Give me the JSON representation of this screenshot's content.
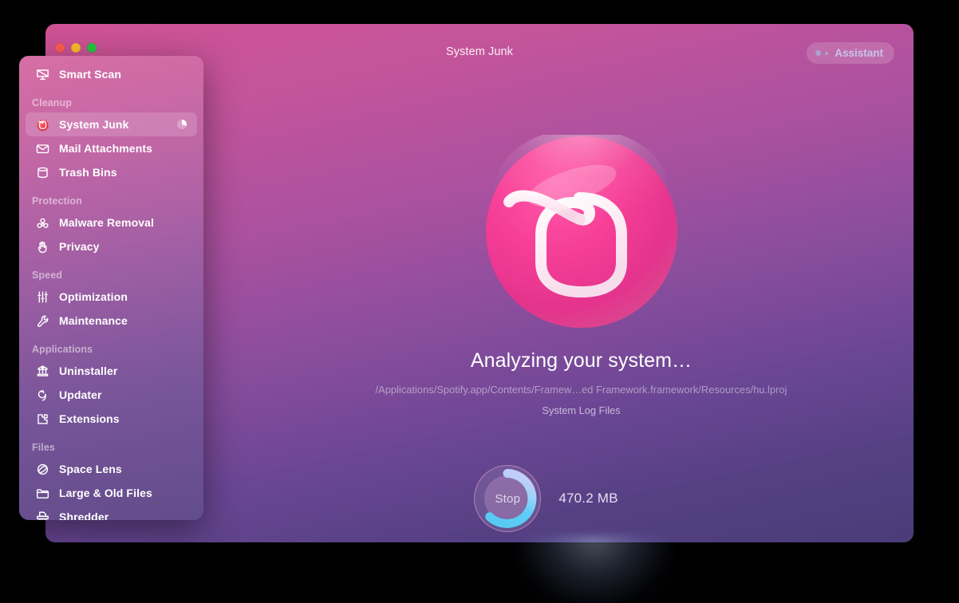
{
  "window": {
    "title": "System Junk",
    "traffic_lights": [
      "close",
      "minimize",
      "zoom"
    ],
    "assistant_label": "Assistant"
  },
  "sidebar": {
    "top_items": [
      {
        "label": "Smart Scan",
        "icon": "smart-scan-icon",
        "active": false
      }
    ],
    "groups": [
      {
        "title": "Cleanup",
        "items": [
          {
            "label": "System Junk",
            "icon": "system-junk-icon",
            "active": true,
            "progress_pie": 0.3
          },
          {
            "label": "Mail Attachments",
            "icon": "mail-icon",
            "active": false
          },
          {
            "label": "Trash Bins",
            "icon": "trash-bin-icon",
            "active": false
          }
        ]
      },
      {
        "title": "Protection",
        "items": [
          {
            "label": "Malware Removal",
            "icon": "biohazard-icon",
            "active": false
          },
          {
            "label": "Privacy",
            "icon": "hand-icon",
            "active": false
          }
        ]
      },
      {
        "title": "Speed",
        "items": [
          {
            "label": "Optimization",
            "icon": "sliders-icon",
            "active": false
          },
          {
            "label": "Maintenance",
            "icon": "wrench-icon",
            "active": false
          }
        ]
      },
      {
        "title": "Applications",
        "items": [
          {
            "label": "Uninstaller",
            "icon": "uninstaller-icon",
            "active": false
          },
          {
            "label": "Updater",
            "icon": "refresh-arrow-icon",
            "active": false
          },
          {
            "label": "Extensions",
            "icon": "puzzle-piece-icon",
            "active": false
          }
        ]
      },
      {
        "title": "Files",
        "items": [
          {
            "label": "Space Lens",
            "icon": "space-lens-icon",
            "active": false
          },
          {
            "label": "Large & Old Files",
            "icon": "folder-icon",
            "active": false
          },
          {
            "label": "Shredder",
            "icon": "shredder-icon",
            "active": false
          }
        ]
      }
    ]
  },
  "main": {
    "logo": "cleanmymac-sphere-logo",
    "status_title": "Analyzing your system…",
    "current_path": "/Applications/Spotify.app/Contents/Framew…ed Framework.framework/Resources/hu.lproj",
    "current_category": "System Log Files"
  },
  "footer": {
    "stop_label": "Stop",
    "scanned_size": "470.2 MB",
    "progress_fraction": 0.72
  },
  "colors": {
    "accent_pink": "#e8449a",
    "progress_cyan": "#58cdf5",
    "progress_periwinkle": "#b9c6f7",
    "bg_top": "#cf5294",
    "bg_bottom": "#4a3c78"
  }
}
